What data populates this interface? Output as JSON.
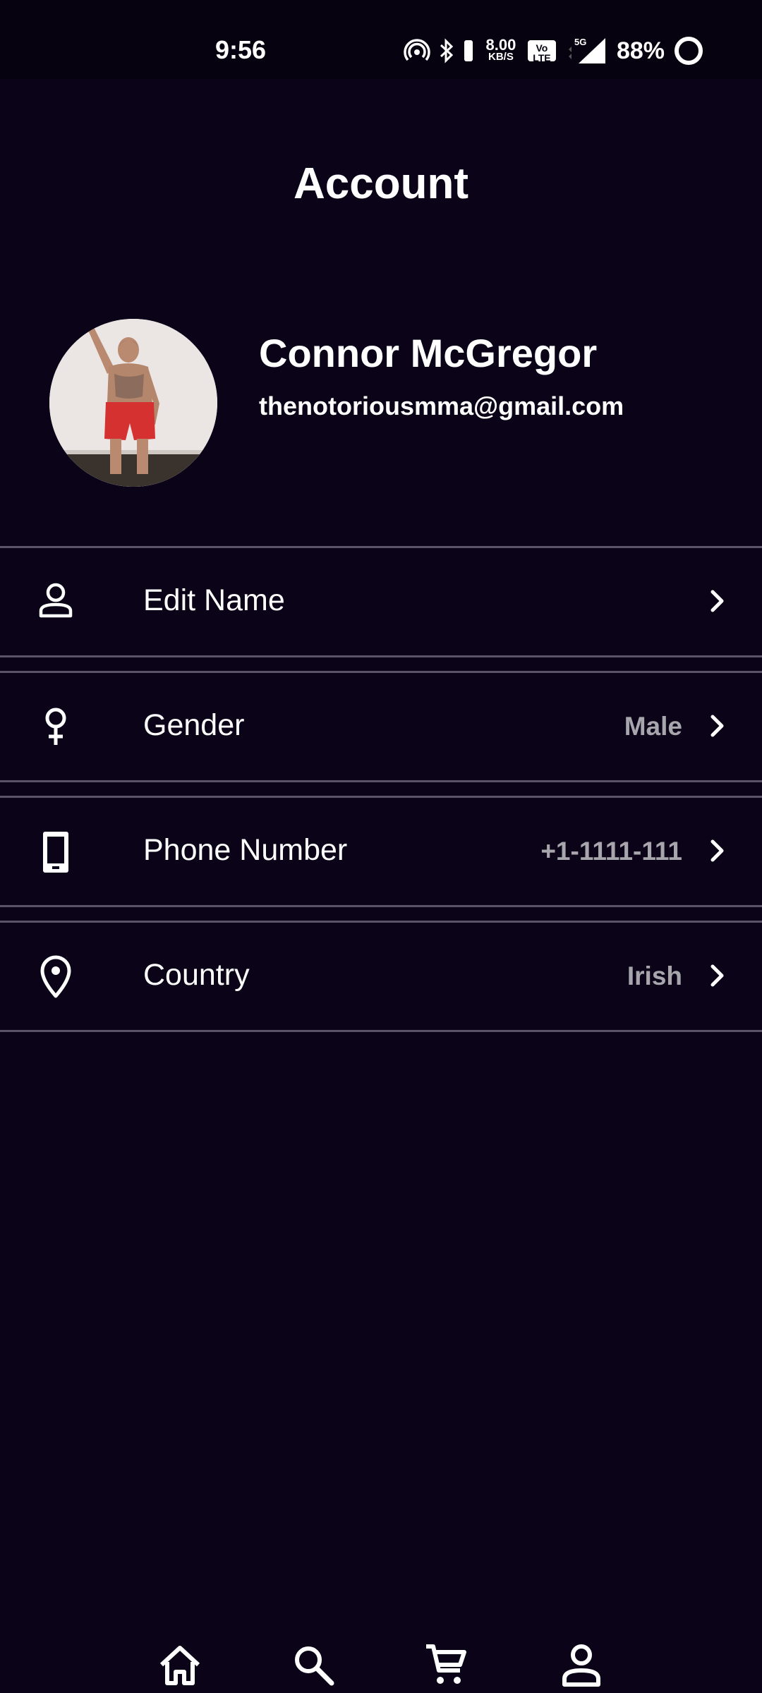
{
  "status_bar": {
    "time": "9:56",
    "net_speed_value": "8.00",
    "net_speed_unit": "KB/S",
    "volte_label": "Vo LTE",
    "network_type": "5G",
    "battery_percent": "88%",
    "icons": [
      "hotspot-icon",
      "bluetooth-icon",
      "vibrate-icon",
      "signal-icon",
      "battery-ring-icon"
    ]
  },
  "page": {
    "title": "Account"
  },
  "profile": {
    "name": "Connor McGregor",
    "email": "thenotoriousmma@gmail.com",
    "avatar_icon": "profile-photo"
  },
  "settings": {
    "items": [
      {
        "label": "Edit Name",
        "value": "",
        "icon": "person-icon"
      },
      {
        "label": "Gender",
        "value": "Male",
        "icon": "gender-icon"
      },
      {
        "label": "Phone Number",
        "value": "+1-1111-111",
        "icon": "phone-icon"
      },
      {
        "label": "Country",
        "value": "Irish",
        "icon": "location-pin-icon"
      }
    ]
  },
  "bottom_nav": {
    "items": [
      "home-icon",
      "search-icon",
      "cart-icon",
      "profile-icon"
    ]
  },
  "colors": {
    "background": "#0b0418",
    "divider": "#5a5566",
    "secondary_text": "#a8a6ad"
  }
}
